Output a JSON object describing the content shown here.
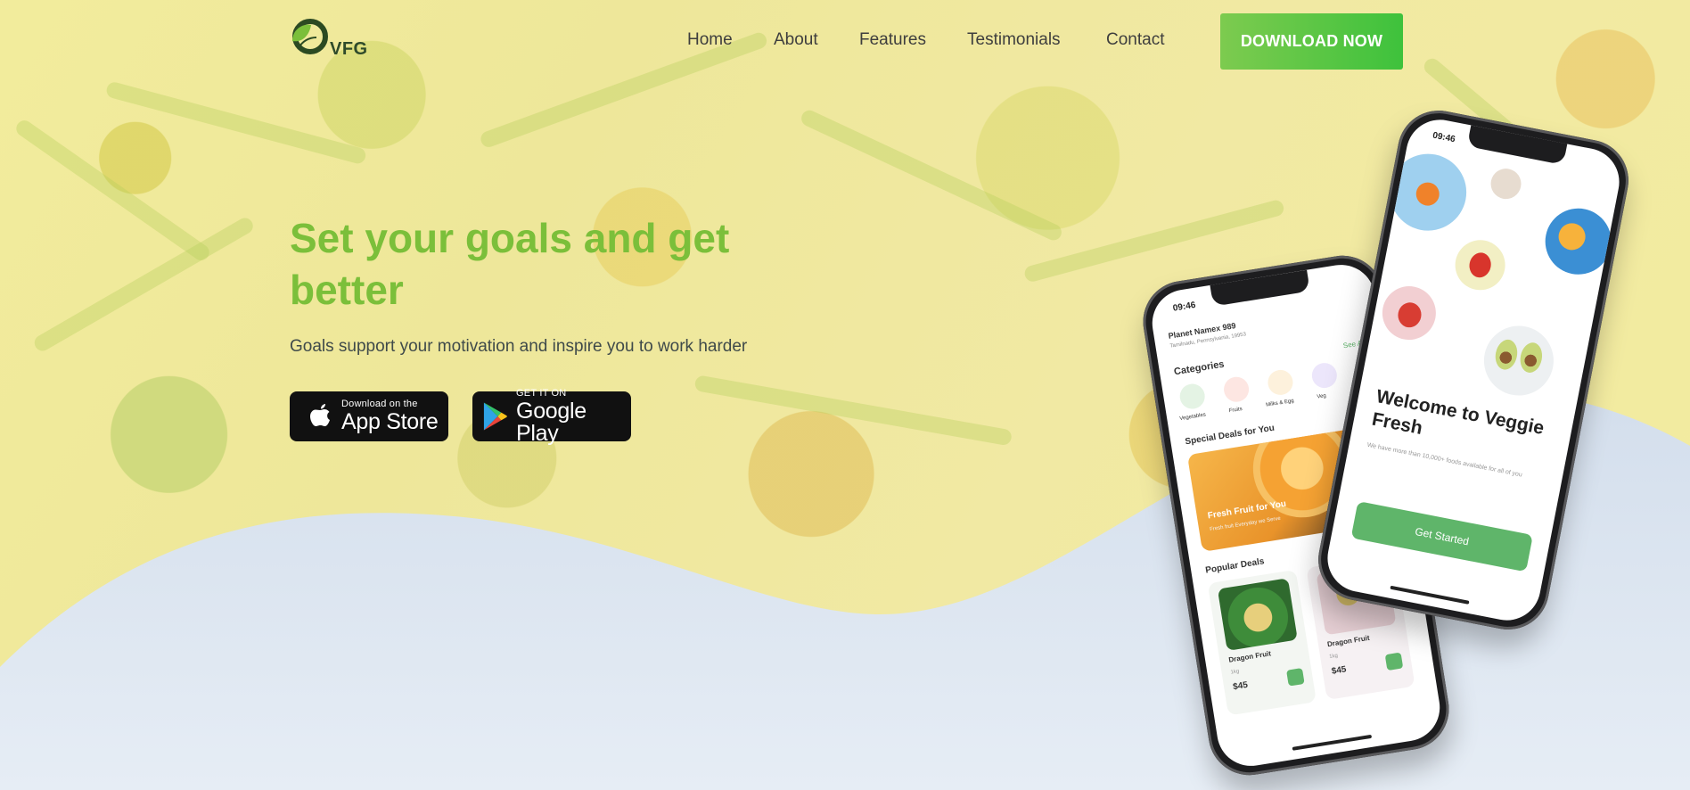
{
  "brand": {
    "logo_text": "VFG"
  },
  "nav": {
    "items": [
      "Home",
      "About",
      "Features",
      "Testimonials",
      "Contact"
    ],
    "cta_label": "DOWNLOAD NOW"
  },
  "hero": {
    "title": "Set your goals and get better",
    "subtitle": "Goals support your motivation and inspire you to work harder"
  },
  "badges": {
    "apple": {
      "small": "Download on the",
      "big": "App Store"
    },
    "google": {
      "small": "GET IT ON",
      "big": "Google Play"
    }
  },
  "phone_back": {
    "time": "09:46",
    "location_title": "Planet Namex 989",
    "location_sub": "Tamilnadu, Pennsylvania, 19953",
    "categories_title": "Categories",
    "see_all": "See All",
    "categories": [
      "Vegetables",
      "Fruits",
      "Milks & Egg",
      "Veg"
    ],
    "special_title": "Special Deals for You",
    "special_card_title": "Fresh Fruit for You",
    "special_card_sub": "Fresh fruit Everyday we Serve",
    "popular_title": "Popular Deals",
    "popular": [
      {
        "name": "Dragon Fruit",
        "weight": "1kg",
        "price": "$45"
      },
      {
        "name": "Dragon Fruit",
        "weight": "1kg",
        "price": "$45"
      }
    ]
  },
  "phone_front": {
    "time": "09:46",
    "welcome": "Welcome to Veggie Fresh",
    "welcome_sub": "We have more than 10,000+ foods available for all of you",
    "button": "Get Started"
  },
  "colors": {
    "accent_green": "#7bbf3a",
    "cta_gradient_start": "#7dcb4f",
    "cta_gradient_end": "#3ec23c",
    "wave": "#d6e2ee"
  },
  "icons": [
    "leaf-logo-icon",
    "apple-icon",
    "google-play-icon"
  ]
}
